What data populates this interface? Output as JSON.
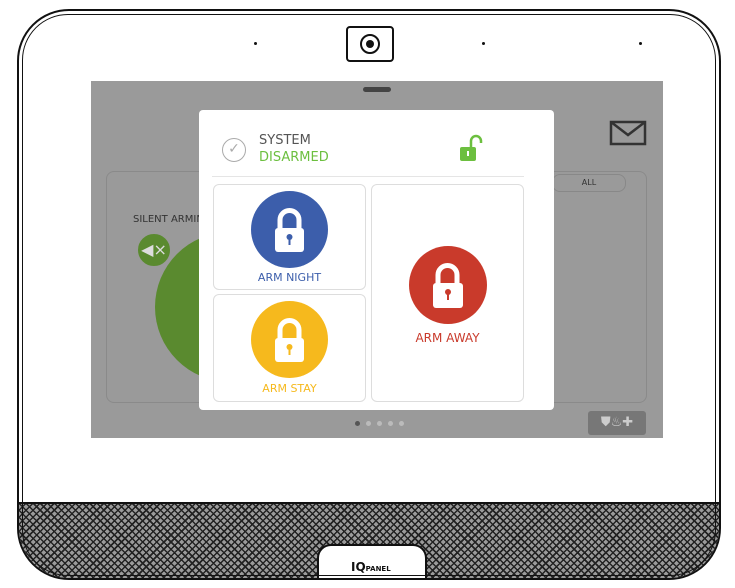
{
  "status": {
    "line1": "SYSTEM",
    "line2": "DISARMED",
    "color": "#6cbf3f"
  },
  "background": {
    "silent_arming": "SILENT ARMING",
    "filter_all": "ALL"
  },
  "actions": [
    {
      "label": "ARM NIGHT",
      "color": "#3c5eab",
      "icon": "lock-icon"
    },
    {
      "label": "ARM STAY",
      "color": "#f6b91d",
      "icon": "lock-icon"
    },
    {
      "label": "ARM AWAY",
      "color": "#c93a2b",
      "icon": "lock-icon"
    }
  ],
  "pagination": {
    "pages": 5,
    "current": 1
  },
  "brand": {
    "logo": "IQ PANEL"
  },
  "icons": [
    "envelope-icon",
    "unlock-icon",
    "check-circle-icon",
    "speaker-mute-icon",
    "chevron-right-icon",
    "shield-icon",
    "fire-icon",
    "medical-cross-icon"
  ]
}
